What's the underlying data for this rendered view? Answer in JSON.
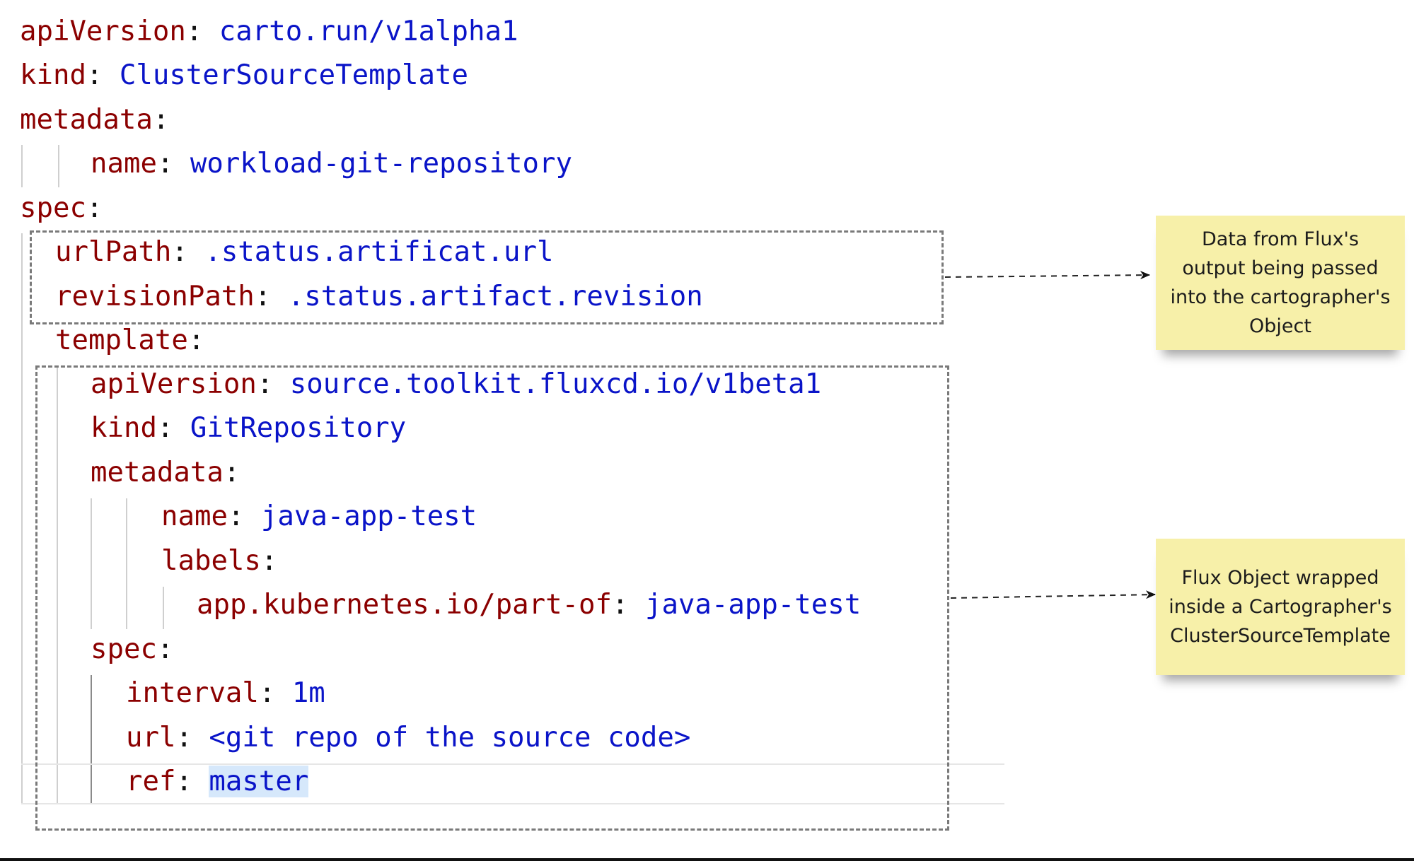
{
  "code": {
    "language": "yaml",
    "lines": [
      {
        "key": "apiVersion",
        "value": "carto.run/v1alpha1"
      },
      {
        "key": "kind",
        "value": "ClusterSourceTemplate"
      },
      {
        "key": "metadata",
        "value": ""
      },
      {
        "key": "name",
        "value": "workload-git-repository"
      },
      {
        "key": "spec",
        "value": ""
      },
      {
        "key": "urlPath",
        "value": ".status.artificat.url"
      },
      {
        "key": "revisionPath",
        "value": ".status.artifact.revision"
      },
      {
        "key": "template",
        "value": ""
      },
      {
        "key": "apiVersion",
        "value": "source.toolkit.fluxcd.io/v1beta1"
      },
      {
        "key": "kind",
        "value": "GitRepository"
      },
      {
        "key": "metadata",
        "value": ""
      },
      {
        "key": "name",
        "value": "java-app-test"
      },
      {
        "key": "labels",
        "value": ""
      },
      {
        "key": "app.kubernetes.io/part-of",
        "value": "java-app-test"
      },
      {
        "key": "spec",
        "value": ""
      },
      {
        "key": "interval",
        "value": "1m"
      },
      {
        "key": "url",
        "value": "<git repo of the source code>"
      },
      {
        "key": "ref",
        "value": "master"
      }
    ],
    "colon": ":",
    "selected_text": "master"
  },
  "annotations": [
    {
      "text": "Data from Flux's\noutput being passed\ninto the cartographer's\nObject"
    },
    {
      "text": "Flux Object wrapped\ninside a Cartographer's\nClusterSourceTemplate"
    }
  ],
  "colors": {
    "key": "#8b0000",
    "value": "#0a14c8",
    "note_bg": "#f7f0a9",
    "selection": "#d6e8fb"
  }
}
